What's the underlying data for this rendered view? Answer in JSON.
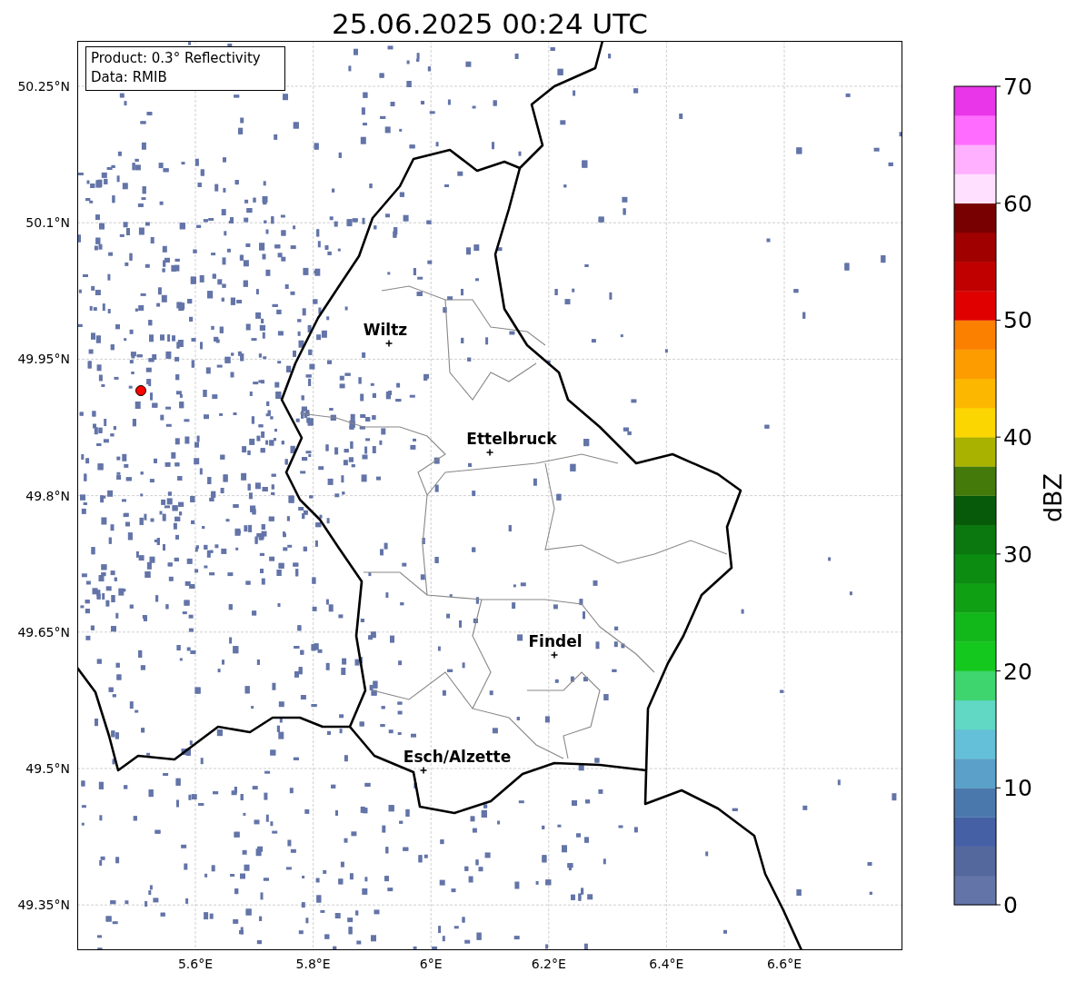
{
  "title": "25.06.2025 00:24 UTC",
  "info_box": {
    "lines": [
      "Product: 0.3° Reflectivity",
      "Data: RMIB"
    ]
  },
  "map": {
    "latitude_labels": [
      "50.25°N",
      "50.1°N",
      "49.95°N",
      "49.8°N",
      "49.65°N",
      "49.5°N",
      "49.35°N"
    ],
    "longitude_labels": [
      "5.6°E",
      "5.8°E",
      "6°E",
      "6.2°E",
      "6.4°E",
      "6.6°E"
    ],
    "cities": [
      {
        "name": "Wiltz"
      },
      {
        "name": "Ettelbruck"
      },
      {
        "name": "Findel"
      },
      {
        "name": "Esch/Alzette"
      }
    ]
  },
  "colorbar": {
    "label": "dBZ",
    "ticks": [
      "70",
      "60",
      "50",
      "40",
      "30",
      "20",
      "10",
      "0"
    ],
    "bands": [
      {
        "color": "#6374a8"
      },
      {
        "color": "#54689e"
      },
      {
        "color": "#4560a4"
      },
      {
        "color": "#4a78ad"
      },
      {
        "color": "#5aa0c8"
      },
      {
        "color": "#64c0d8"
      },
      {
        "color": "#60d8c4"
      },
      {
        "color": "#3ed56e"
      },
      {
        "color": "#14c81e"
      },
      {
        "color": "#12b81a"
      },
      {
        "color": "#10a014"
      },
      {
        "color": "#0c8c10"
      },
      {
        "color": "#0a780e"
      },
      {
        "color": "#065a0a"
      },
      {
        "color": "#437a0a"
      },
      {
        "color": "#aab200"
      },
      {
        "color": "#fcd600"
      },
      {
        "color": "#fcb800"
      },
      {
        "color": "#fc9c00"
      },
      {
        "color": "#fc8000"
      },
      {
        "color": "#e00000"
      },
      {
        "color": "#c00000"
      },
      {
        "color": "#a00000"
      },
      {
        "color": "#780000"
      },
      {
        "color": "#ffe0ff"
      },
      {
        "color": "#ffb0ff"
      },
      {
        "color": "#ff6cff"
      },
      {
        "color": "#e836e8"
      }
    ]
  }
}
